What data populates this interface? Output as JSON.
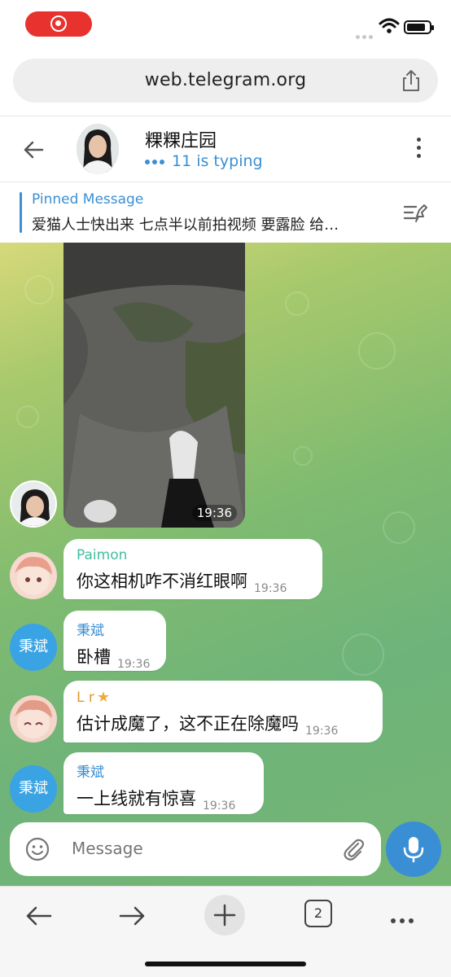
{
  "browser": {
    "url": "web.telegram.org",
    "tabs_count": "2"
  },
  "chat": {
    "title": "粿粿庄园",
    "status": "11 is typing"
  },
  "pinned": {
    "title": "Pinned Message",
    "text": "爱猫人士快出来 七点半以前拍视频 要露脸 给…"
  },
  "messages": [
    {
      "type": "media",
      "time": "19:36"
    },
    {
      "sender": "Paimon",
      "sender_color": "#3fbf9f",
      "text": "你这相机咋不消红眼啊",
      "time": "19:36"
    },
    {
      "sender": "秉斌",
      "sender_color": "#3a8fd4",
      "avatar_text": "秉斌",
      "text": "卧槽",
      "time": "19:36"
    },
    {
      "sender": "L r",
      "sender_color": "#e0982c",
      "text": "估计成魔了，这不正在除魔吗",
      "time": "19:36"
    },
    {
      "sender": "秉斌",
      "sender_color": "#3a8fd4",
      "avatar_text": "秉斌",
      "text": "一上线就有惊喜",
      "time": "19:36"
    }
  ],
  "composer": {
    "placeholder": "Message"
  },
  "colors": {
    "accent": "#3a8fd4",
    "record": "#e8322e"
  },
  "icons": [
    "record-icon",
    "wifi-icon",
    "battery-icon",
    "share-icon",
    "back-arrow-icon",
    "more-vert-icon",
    "unpin-icon",
    "emoji-icon",
    "attach-icon",
    "mic-icon",
    "arrow-left-icon",
    "arrow-right-icon",
    "plus-icon",
    "tabs-icon",
    "more-horiz-icon"
  ]
}
